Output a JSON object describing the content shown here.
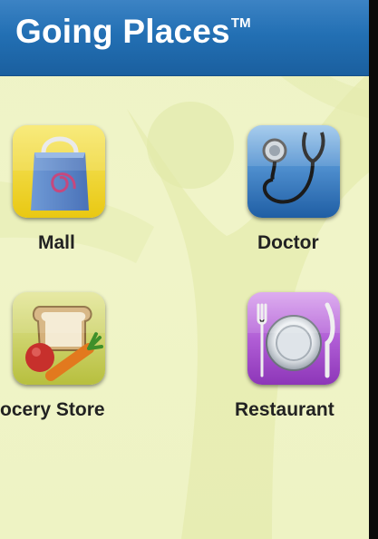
{
  "header": {
    "title": "Going Places",
    "trademark": "TM"
  },
  "apps": [
    {
      "label": "Mall",
      "icon": "shopping-bag-icon"
    },
    {
      "label": "Doctor",
      "icon": "stethoscope-icon"
    },
    {
      "label": "ocery Store",
      "icon": "groceries-icon"
    },
    {
      "label": "Restaurant",
      "icon": "plate-icon"
    }
  ],
  "colors": {
    "header": "#2370b4",
    "background": "#eef3c6",
    "mall_icon": "#f2d727",
    "doctor_icon": "#2a6fb5",
    "grocery_icon": "#c9cf5a",
    "restaurant_icon": "#a64fcf"
  }
}
